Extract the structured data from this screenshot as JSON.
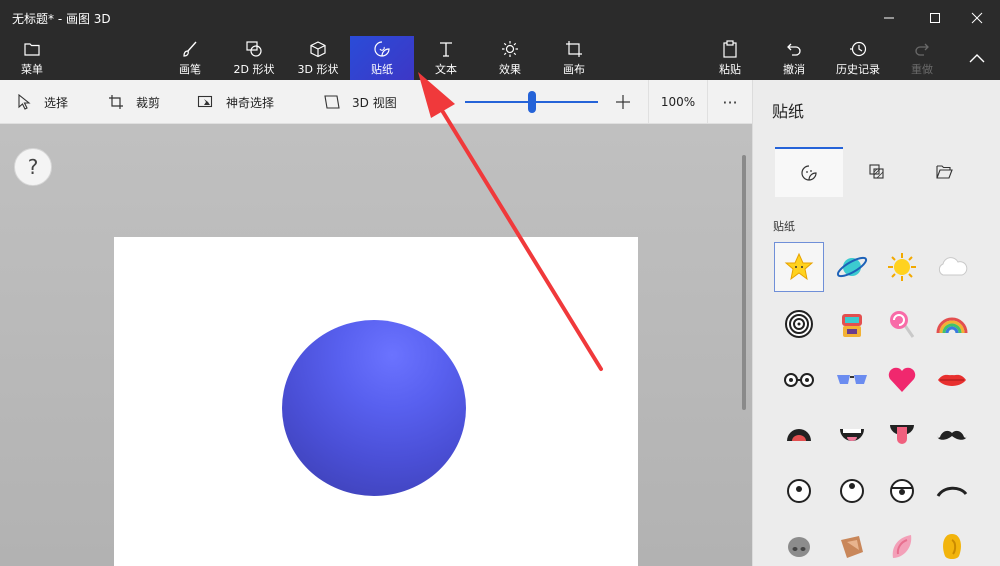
{
  "window": {
    "title": "无标题* - 画图 3D"
  },
  "ribbon": {
    "menu_label": "菜单",
    "tools": [
      {
        "label": "画笔"
      },
      {
        "label": "2D 形状"
      },
      {
        "label": "3D 形状"
      },
      {
        "label": "贴纸"
      },
      {
        "label": "文本"
      },
      {
        "label": "效果"
      },
      {
        "label": "画布"
      }
    ],
    "actions": [
      {
        "label": "粘贴"
      },
      {
        "label": "撤消"
      },
      {
        "label": "历史记录"
      },
      {
        "label": "重做"
      }
    ]
  },
  "toolbar": {
    "select_label": "选择",
    "crop_label": "裁剪",
    "magic_select_label": "神奇选择",
    "view3d_label": "3D 视图",
    "zoom_percent": "100%",
    "zoom_fraction": 0.5
  },
  "help": {
    "label": "?"
  },
  "panel": {
    "title": "贴纸",
    "section_label": "贴纸",
    "stickers": [
      "star-sticker",
      "planet-sticker",
      "sun-sticker",
      "cloud-sticker",
      "spiral-sticker",
      "robot-sticker",
      "lollipop-sticker",
      "rainbow-sticker",
      "glasses-sticker",
      "sunglasses-sticker",
      "heart-sticker",
      "lips-sticker",
      "open-mouth-sticker",
      "grin-mouth-sticker",
      "tongue-sticker",
      "mustache-sticker",
      "eye-sticker",
      "eye-sticker-2",
      "eye-sticker-3",
      "eyebrow-sticker",
      "nose-sticker",
      "ear-sticker",
      "pink-ear-sticker",
      "yellow-ear-sticker"
    ]
  },
  "colors": {
    "accent": "#2563d8",
    "sphere": "#5860ef",
    "annotation_arrow": "#f0393b"
  }
}
